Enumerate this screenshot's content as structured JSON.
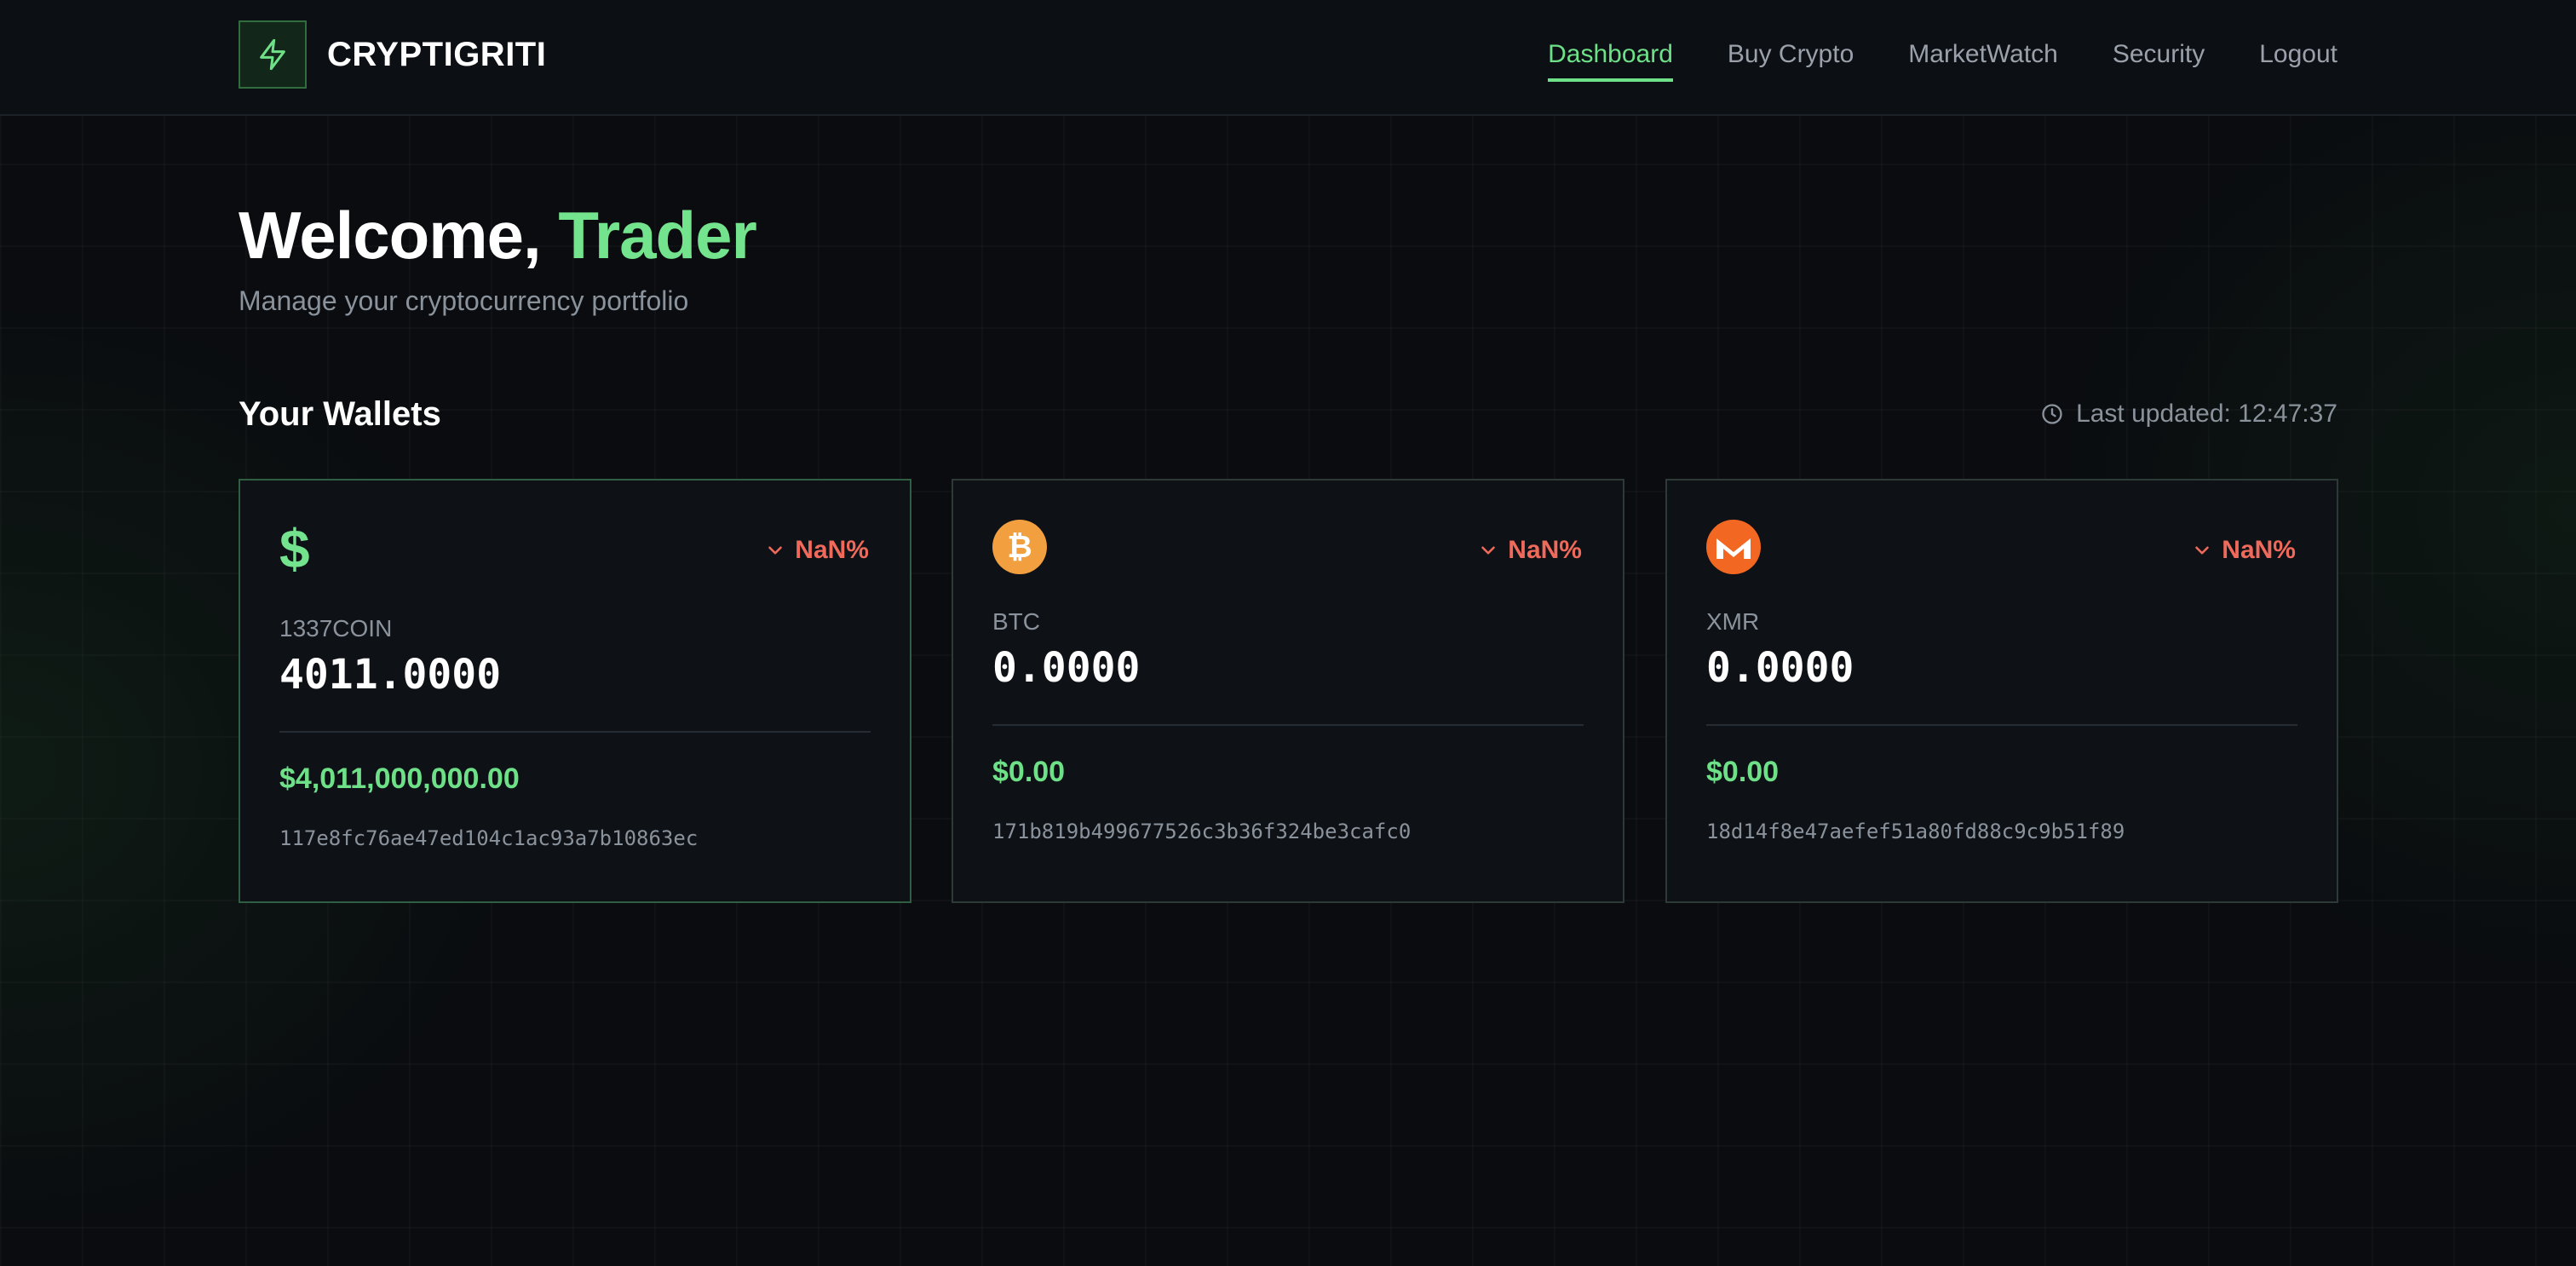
{
  "app": {
    "brand": "CRYPTIGRITI"
  },
  "nav": {
    "items": [
      {
        "label": "Dashboard",
        "active": true
      },
      {
        "label": "Buy Crypto",
        "active": false
      },
      {
        "label": "MarketWatch",
        "active": false
      },
      {
        "label": "Security",
        "active": false
      },
      {
        "label": "Logout",
        "active": false
      }
    ]
  },
  "welcome": {
    "greeting": "Welcome, ",
    "name": "Trader",
    "subtitle": "Manage your cryptocurrency portfolio"
  },
  "wallets": {
    "title": "Your Wallets",
    "last_updated_label": "Last updated: 12:47:37",
    "cards": [
      {
        "icon": "dollar-icon",
        "icon_glyph": "$",
        "name": "1337COIN",
        "change": "NaN%",
        "balance": "4011.0000",
        "usd": "$4,011,000,000.00",
        "address": "117e8fc76ae47ed104c1ac93a7b10863ec"
      },
      {
        "icon": "bitcoin-icon",
        "icon_glyph": "₿",
        "name": "BTC",
        "change": "NaN%",
        "balance": "0.0000",
        "usd": "$0.00",
        "address": "171b819b499677526c3b36f324be3cafc0"
      },
      {
        "icon": "monero-icon",
        "name": "XMR",
        "change": "NaN%",
        "balance": "0.0000",
        "usd": "$0.00",
        "address": "18d14f8e47aefef51a80fd88c9c9b51f89"
      }
    ]
  },
  "colors": {
    "accent_green": "#6ee088",
    "negative_red": "#ef6a5a",
    "bitcoin_orange": "#f2a03f",
    "monero_orange": "#f26822"
  }
}
